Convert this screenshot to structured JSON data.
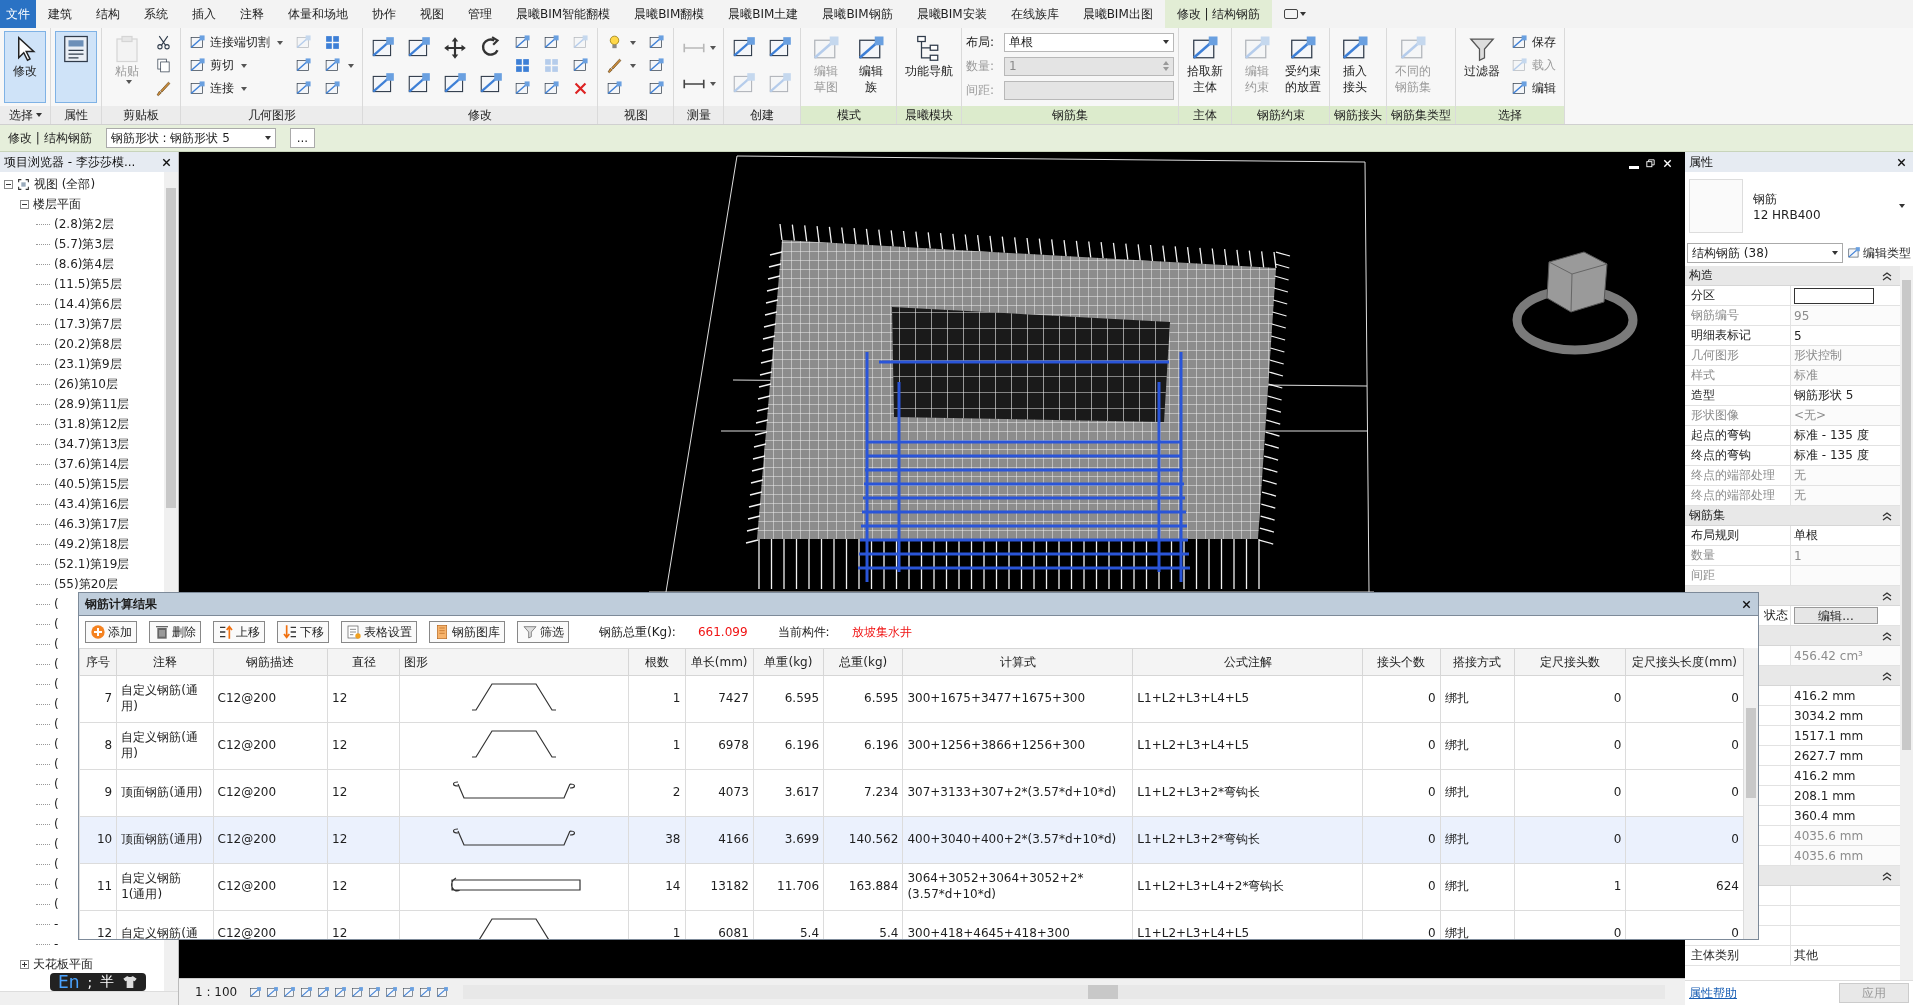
{
  "menu_tabs": [
    {
      "label": "文件",
      "kind": "file",
      "selected": false
    },
    {
      "label": "建筑",
      "kind": "tab",
      "selected": false
    },
    {
      "label": "结构",
      "kind": "tab",
      "selected": false
    },
    {
      "label": "系统",
      "kind": "tab",
      "selected": false
    },
    {
      "label": "插入",
      "kind": "tab",
      "selected": false
    },
    {
      "label": "注释",
      "kind": "tab",
      "selected": false
    },
    {
      "label": "体量和场地",
      "kind": "tab",
      "selected": false
    },
    {
      "label": "协作",
      "kind": "tab",
      "selected": false
    },
    {
      "label": "视图",
      "kind": "tab",
      "selected": false
    },
    {
      "label": "管理",
      "kind": "tab",
      "selected": false
    },
    {
      "label": "晨曦BIM智能翻模",
      "kind": "tab",
      "selected": false
    },
    {
      "label": "晨曦BIM翻模",
      "kind": "tab",
      "selected": false
    },
    {
      "label": "晨曦BIM土建",
      "kind": "tab",
      "selected": false
    },
    {
      "label": "晨曦BIM钢筋",
      "kind": "tab",
      "selected": false
    },
    {
      "label": "晨曦BIM安装",
      "kind": "tab",
      "selected": false
    },
    {
      "label": "在线族库",
      "kind": "tab",
      "selected": false
    },
    {
      "label": "晨曦BIM出图",
      "kind": "tab",
      "selected": false
    },
    {
      "label": "修改 | 结构钢筋",
      "kind": "tab",
      "selected": true
    }
  ],
  "ribbon": {
    "panels": [
      {
        "title": "选择",
        "menu": true,
        "contextual": false,
        "kind": "tools",
        "tools": [
          {
            "kind": "large",
            "label": "修改",
            "disabled": false,
            "selected": true
          }
        ]
      },
      {
        "title": "属性",
        "contextual": false,
        "kind": "tools",
        "tools": [
          {
            "kind": "large",
            "disabled": false,
            "selected": true
          }
        ]
      },
      {
        "title": "剪贴板",
        "contextual": false,
        "kind": "tools",
        "tools": [
          {
            "kind": "large",
            "label": "粘贴",
            "dropdown": true,
            "disabled": true,
            "selected": false
          },
          {
            "kind": "small",
            "disabled": false,
            "selected": false
          },
          {
            "kind": "small",
            "disabled": false,
            "selected": false
          },
          {
            "kind": "small",
            "disabled": false,
            "selected": false
          }
        ]
      },
      {
        "title": "几何图形",
        "contextual": false,
        "kind": "tools",
        "tools": [
          {
            "kind": "small",
            "label": "连接端切割",
            "dropdown": true,
            "disabled": false,
            "selected": false
          },
          {
            "kind": "small",
            "label": "剪切",
            "dropdown": true,
            "disabled": false,
            "selected": false
          },
          {
            "kind": "small",
            "label": "连接",
            "dropdown": true,
            "disabled": false,
            "selected": false
          },
          {
            "kind": "small",
            "disabled": true,
            "selected": false
          },
          {
            "kind": "small",
            "disabled": false,
            "selected": false
          },
          {
            "kind": "small",
            "disabled": false,
            "selected": false
          },
          {
            "kind": "small",
            "disabled": false,
            "selected": false
          },
          {
            "kind": "small",
            "dropdown": true,
            "disabled": false,
            "selected": false
          },
          {
            "kind": "small",
            "disabled": false,
            "selected": false
          }
        ]
      },
      {
        "title": "修改",
        "contextual": false,
        "kind": "tools",
        "tools": [
          {
            "kind": "medium",
            "disabled": false,
            "selected": false
          },
          {
            "kind": "medium",
            "disabled": false,
            "selected": false
          },
          {
            "kind": "medium",
            "disabled": false,
            "selected": false
          },
          {
            "kind": "medium",
            "disabled": false,
            "selected": false
          },
          {
            "kind": "medium",
            "disabled": false,
            "selected": false
          },
          {
            "kind": "medium",
            "disabled": false,
            "selected": false
          },
          {
            "kind": "medium",
            "disabled": false,
            "selected": false
          },
          {
            "kind": "medium",
            "disabled": false,
            "selected": false
          },
          {
            "kind": "small",
            "disabled": false,
            "selected": false
          },
          {
            "kind": "small",
            "disabled": false,
            "selected": false
          },
          {
            "kind": "small",
            "disabled": false,
            "selected": false
          },
          {
            "kind": "small",
            "disabled": false,
            "selected": false
          },
          {
            "kind": "small",
            "disabled": true,
            "selected": false
          },
          {
            "kind": "small",
            "disabled": false,
            "selected": false
          },
          {
            "kind": "small",
            "disabled": true,
            "selected": false
          },
          {
            "kind": "small",
            "disabled": false,
            "selected": false
          },
          {
            "kind": "small",
            "disabled": false,
            "selected": false
          }
        ]
      },
      {
        "title": "视图",
        "contextual": false,
        "kind": "tools",
        "tools": [
          {
            "kind": "small",
            "dropdown": true,
            "disabled": false,
            "selected": false
          },
          {
            "kind": "small",
            "dropdown": true,
            "disabled": false,
            "selected": false
          },
          {
            "kind": "small",
            "disabled": false,
            "selected": false
          },
          {
            "kind": "small",
            "disabled": false,
            "selected": false
          },
          {
            "kind": "small",
            "disabled": false,
            "selected": false
          },
          {
            "kind": "small",
            "disabled": false,
            "selected": false
          }
        ]
      },
      {
        "title": "测量",
        "contextual": false,
        "kind": "tools",
        "tools": [
          {
            "kind": "medium",
            "dropdown": true,
            "disabled": true,
            "selected": false
          },
          {
            "kind": "medium",
            "dropdown": true,
            "disabled": false,
            "selected": false
          }
        ]
      },
      {
        "title": "创建",
        "contextual": false,
        "kind": "tools",
        "tools": [
          {
            "kind": "medium",
            "disabled": false,
            "selected": false
          },
          {
            "kind": "medium",
            "disabled": true,
            "selected": false
          },
          {
            "kind": "medium",
            "disabled": false,
            "selected": false
          },
          {
            "kind": "medium",
            "disabled": true,
            "selected": false
          }
        ]
      },
      {
        "title": "模式",
        "contextual": true,
        "kind": "tools",
        "tools": [
          {
            "kind": "stacked",
            "label": "编辑草图",
            "disabled": true,
            "selected": false
          },
          {
            "kind": "stacked",
            "label": "编辑族",
            "disabled": false,
            "selected": false
          }
        ]
      },
      {
        "title": "晨曦模块",
        "contextual": true,
        "kind": "tools",
        "tools": [
          {
            "kind": "large",
            "label": "功能导航",
            "disabled": false,
            "selected": false
          }
        ]
      },
      {
        "title": "钢筋集",
        "contextual": true,
        "kind": "form",
        "fields": [
          {
            "label": "布局:",
            "value": "单根",
            "kind": "dropdown",
            "disabled": false
          },
          {
            "label": "数量:",
            "value": "1",
            "kind": "spinner",
            "disabled": true
          },
          {
            "label": "间距:",
            "kind": "text",
            "disabled": true
          }
        ]
      },
      {
        "title": "主体",
        "contextual": true,
        "kind": "tools",
        "tools": [
          {
            "kind": "stacked",
            "label": "拾取新主体",
            "disabled": false,
            "selected": false
          }
        ]
      },
      {
        "title": "钢筋约束",
        "contextual": true,
        "kind": "tools",
        "tools": [
          {
            "kind": "stacked",
            "label": "编辑约束",
            "disabled": true,
            "selected": false
          },
          {
            "kind": "stacked",
            "label": "受约束的放置",
            "disabled": false,
            "selected": false
          }
        ]
      },
      {
        "title": "钢筋接头",
        "contextual": true,
        "kind": "tools",
        "tools": [
          {
            "kind": "stacked",
            "label": "插入接头",
            "disabled": false,
            "selected": false
          }
        ]
      },
      {
        "title": "钢筋集类型",
        "contextual": true,
        "kind": "tools",
        "tools": [
          {
            "kind": "stacked",
            "label": "不同的钢筋集",
            "disabled": true,
            "selected": false
          }
        ]
      },
      {
        "title": "选择",
        "contextual": true,
        "kind": "tools",
        "tools": [
          {
            "kind": "large",
            "label": "过滤器",
            "disabled": false,
            "selected": false
          },
          {
            "kind": "small",
            "label": "保存",
            "disabled": false,
            "selected": false
          },
          {
            "kind": "small",
            "label": "载入",
            "disabled": true,
            "selected": false
          },
          {
            "kind": "small",
            "label": "编辑",
            "disabled": false,
            "selected": false
          }
        ]
      }
    ]
  },
  "options_bar": {
    "context": "修改 | 结构钢筋",
    "selector": "钢筋形状 : 钢筋形状 5",
    "more": "..."
  },
  "browser": {
    "title": "项目浏览器 - 李莎莎模...",
    "tree": [
      {
        "label": "视图 (全部)",
        "expanded": true,
        "children": [
          {
            "label": "楼层平面",
            "expanded": true,
            "children": [
              {
                "label": "(2.8)第2层"
              },
              {
                "label": "(5.7)第3层"
              },
              {
                "label": "(8.6)第4层"
              },
              {
                "label": "(11.5)第5层"
              },
              {
                "label": "(14.4)第6层"
              },
              {
                "label": "(17.3)第7层"
              },
              {
                "label": "(20.2)第8层"
              },
              {
                "label": "(23.1)第9层"
              },
              {
                "label": "(26)第10层"
              },
              {
                "label": "(28.9)第11层"
              },
              {
                "label": "(31.8)第12层"
              },
              {
                "label": "(34.7)第13层"
              },
              {
                "label": "(37.6)第14层"
              },
              {
                "label": "(40.5)第15层"
              },
              {
                "label": "(43.4)第16层"
              },
              {
                "label": "(46.3)第17层"
              },
              {
                "label": "(49.2)第18层"
              },
              {
                "label": "(52.1)第19层"
              },
              {
                "label": "(55)第20层"
              },
              {
                "label": "("
              },
              {
                "label": "("
              },
              {
                "label": "("
              },
              {
                "label": "("
              },
              {
                "label": "("
              },
              {
                "label": "("
              },
              {
                "label": "("
              },
              {
                "label": "("
              },
              {
                "label": "("
              },
              {
                "label": "("
              },
              {
                "label": "("
              },
              {
                "label": "("
              },
              {
                "label": "("
              },
              {
                "label": "("
              },
              {
                "label": "("
              },
              {
                "label": "("
              },
              {
                "label": "-"
              },
              {
                "label": "-"
              }
            ]
          },
          {
            "label": "天花板平面",
            "expanded": false
          }
        ]
      }
    ]
  },
  "view_bar": {
    "scale": "1 : 100"
  },
  "ime": {
    "mode": "En",
    "punctuation": ";",
    "width": "半"
  },
  "properties": {
    "title": "属性",
    "type_name": "钢筋",
    "type_value": "12 HRB400",
    "selector": "结构钢筋 (38)",
    "edit_type": "编辑类型",
    "groups": [
      {
        "title": "构造",
        "expanded": true,
        "rows": [
          {
            "label": "分区",
            "kind": "input",
            "disabled": false
          },
          {
            "label": "钢筋编号",
            "value": "95",
            "kind": "text",
            "disabled": true
          },
          {
            "label": "明细表标记",
            "value": "5",
            "kind": "text",
            "disabled": false
          },
          {
            "label": "几何图形",
            "value": "形状控制",
            "kind": "text",
            "disabled": true
          },
          {
            "label": "样式",
            "value": "标准",
            "kind": "text",
            "disabled": true
          },
          {
            "label": "造型",
            "value": "钢筋形状 5",
            "kind": "text",
            "disabled": false
          },
          {
            "label": "形状图像",
            "value": "<无>",
            "kind": "text",
            "disabled": true
          },
          {
            "label": "起点的弯钩",
            "value": "标准 - 135 度",
            "kind": "text",
            "disabled": false
          },
          {
            "label": "终点的弯钩",
            "value": "标准 - 135 度",
            "kind": "text",
            "disabled": false
          },
          {
            "label": "终点的端部处理",
            "value": "无",
            "kind": "text",
            "disabled": true
          },
          {
            "label": "终点的端部处理",
            "value": "无",
            "kind": "text",
            "disabled": true
          }
        ]
      },
      {
        "title": "钢筋集",
        "expanded": true,
        "rows": [
          {
            "label": "布局规则",
            "value": "单根",
            "kind": "text",
            "disabled": false
          },
          {
            "label": "数量",
            "value": "1",
            "kind": "text",
            "disabled": true
          },
          {
            "label": "间距",
            "kind": "text",
            "disabled": true
          }
        ]
      },
      {
        "expanded": true,
        "rows": [
          {
            "label": "状态",
            "value": "编辑...",
            "kind": "button",
            "disabled": false
          }
        ]
      },
      {
        "expanded": true,
        "rows": [
          {
            "value": "456.42 cm³",
            "kind": "text",
            "disabled": true
          }
        ]
      },
      {
        "expanded": true,
        "rows": [
          {
            "value": "416.2 mm",
            "kind": "text",
            "disabled": false
          },
          {
            "value": "3034.2 mm",
            "kind": "text",
            "disabled": false
          },
          {
            "value": "1517.1 mm",
            "kind": "text",
            "disabled": false
          },
          {
            "value": "2627.7 mm",
            "kind": "text",
            "disabled": false
          },
          {
            "value": "416.2 mm",
            "kind": "text",
            "disabled": false
          },
          {
            "value": "208.1 mm",
            "kind": "text",
            "disabled": false
          },
          {
            "value": "360.4 mm",
            "kind": "text",
            "disabled": false
          },
          {
            "value": "4035.6 mm",
            "kind": "text",
            "disabled": true
          },
          {
            "value": "4035.6 mm",
            "kind": "text",
            "disabled": true
          }
        ]
      },
      {
        "expanded": true,
        "rows": [
          {
            "kind": "text"
          },
          {
            "kind": "text"
          },
          {
            "kind": "text"
          },
          {
            "label": "主体类别",
            "value": "其他",
            "kind": "text",
            "disabled": false
          }
        ]
      }
    ],
    "help": "属性帮助",
    "apply": {
      "label": "应用",
      "disabled": true
    }
  },
  "dialog": {
    "title": "钢筋计算结果",
    "toolbar": [
      "添加",
      "删除",
      "上移",
      "下移",
      "表格设置",
      "钢筋图库",
      "筛选"
    ],
    "summary": [
      {
        "label": "钢筋总重(Kg):",
        "value": "661.099"
      },
      {
        "label": "当前构件:",
        "value": "放坡集水井"
      }
    ],
    "table": {
      "columns": [
        "序号",
        "注释",
        "钢筋描述",
        "直径",
        "图形",
        "根数",
        "单长(mm)",
        "单重(kg)",
        "总重(kg)",
        "计算式",
        "公式注解",
        "接头个数",
        "搭接方式",
        "定尺接头数",
        "定尺接头长度(mm)"
      ],
      "rows": [
        {
          "selected": false,
          "kind": "trapezoid",
          "cells": [
            "7",
            "自定义钢筋(通用)",
            "C12@200",
            "12",
            "",
            "1",
            "7427",
            "6.595",
            "6.595",
            "300+1675+3477+1675+300",
            "L1+L2+L3+L4+L5",
            "0",
            "绑扎",
            "0",
            "0"
          ]
        },
        {
          "selected": false,
          "kind": "trapezoid",
          "cells": [
            "8",
            "自定义钢筋(通用)",
            "C12@200",
            "12",
            "",
            "1",
            "6978",
            "6.196",
            "6.196",
            "300+1256+3866+1256+300",
            "L1+L2+L3+L4+L5",
            "0",
            "绑扎",
            "0",
            "0"
          ]
        },
        {
          "selected": false,
          "kind": "hooked",
          "cells": [
            "9",
            "顶面钢筋(通用)",
            "C12@200",
            "12",
            "",
            "2",
            "4073",
            "3.617",
            "7.234",
            "307+3133+307+2*(3.57*d+10*d)",
            "L1+L2+L3+2*弯钩长",
            "0",
            "绑扎",
            "0",
            "0"
          ]
        },
        {
          "selected": true,
          "kind": "hooked",
          "cells": [
            "10",
            "顶面钢筋(通用)",
            "C12@200",
            "12",
            "",
            "38",
            "4166",
            "3.699",
            "140.562",
            "400+3040+400+2*(3.57*d+10*d)",
            "L1+L2+L3+2*弯钩长",
            "0",
            "绑扎",
            "0",
            "0"
          ]
        },
        {
          "selected": false,
          "kind": "straight",
          "cells": [
            "11",
            "自定义钢筋 1(通用)",
            "C12@200",
            "12",
            "",
            "14",
            "13182",
            "11.706",
            "163.884",
            "3064+3052+3064+3052+2*(3.57*d+10*d)",
            "L1+L2+L3+L4+2*弯钩长",
            "0",
            "绑扎",
            "1",
            "624"
          ]
        },
        {
          "selected": false,
          "kind": "trapezoid",
          "cells": [
            "12",
            "自定义钢筋(通",
            "C12@200",
            "12",
            "",
            "1",
            "6081",
            "5.4",
            "5.4",
            "300+418+4645+418+300",
            "L1+L2+L3+L4+L5",
            "0",
            "绑扎",
            "0",
            "0"
          ]
        }
      ]
    }
  }
}
